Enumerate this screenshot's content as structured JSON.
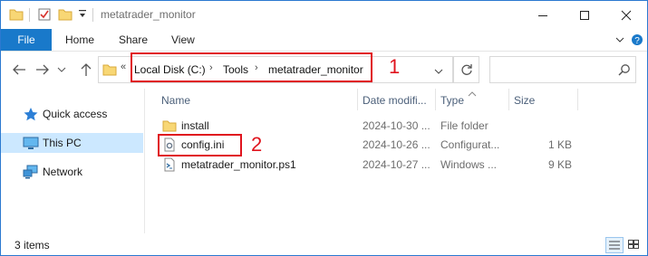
{
  "window": {
    "title": "metatrader_monitor",
    "buttons": {
      "minimize": "minimize-icon",
      "maximize": "maximize-icon",
      "close": "close-icon"
    }
  },
  "ribbon": {
    "file": "File",
    "tabs": [
      "Home",
      "Share",
      "View"
    ]
  },
  "address": {
    "overflow": "«",
    "crumbs": [
      "Local Disk (C:)",
      "Tools",
      "metatrader_monitor"
    ],
    "separator": "›",
    "search_placeholder": ""
  },
  "annotations": [
    "1",
    "2"
  ],
  "nav": {
    "items": [
      {
        "label": "Quick access",
        "icon": "star-icon"
      },
      {
        "label": "This PC",
        "icon": "pc-icon"
      },
      {
        "label": "Network",
        "icon": "network-icon"
      }
    ]
  },
  "columns": [
    "Name",
    "Date modifi...",
    "Type",
    "Size"
  ],
  "files": [
    {
      "name": "install",
      "date": "2024-10-30 ...",
      "type": "File folder",
      "size": "",
      "icon": "folder-icon"
    },
    {
      "name": "config.ini",
      "date": "2024-10-26 ...",
      "type": "Configurat...",
      "size": "1 KB",
      "icon": "config-file-icon"
    },
    {
      "name": "metatrader_monitor.ps1",
      "date": "2024-10-27 ...",
      "type": "Windows ...",
      "size": "9 KB",
      "icon": "script-file-icon"
    }
  ],
  "status": {
    "item_count": "3 items"
  },
  "colors": {
    "accent": "#1979ca",
    "selection": "#cce8ff",
    "annotation": "#e0141e"
  }
}
